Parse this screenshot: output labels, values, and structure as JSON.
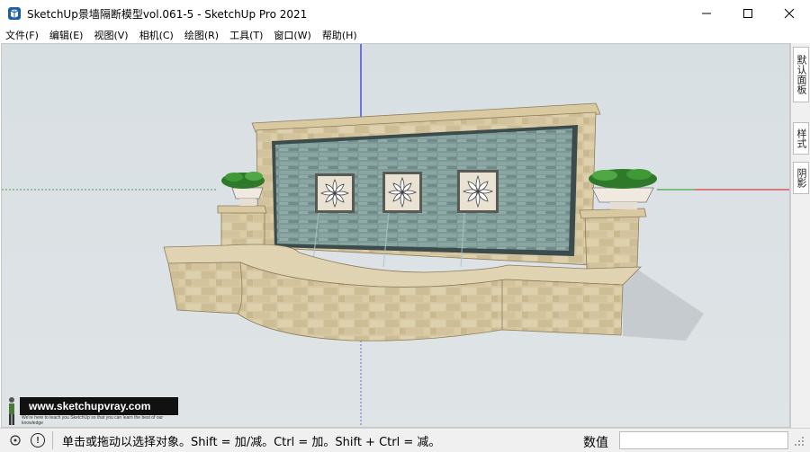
{
  "window": {
    "title": "SketchUp景墙隔断模型vol.061-5 - SketchUp Pro 2021",
    "app_icon": "sketchup-logo-icon"
  },
  "window_controls": [
    "minimize-icon",
    "maximize-icon",
    "close-icon"
  ],
  "menu": [
    "文件(F)",
    "编辑(E)",
    "视图(V)",
    "相机(C)",
    "绘图(R)",
    "工具(T)",
    "窗口(W)",
    "帮助(H)"
  ],
  "tray": {
    "tabs": [
      "默认面板",
      "样式",
      "阴影"
    ]
  },
  "watermark": {
    "site": "www.sketchupvray.com",
    "subtitle": "We're here to teach you SketchUp so that you can learn the best of our knowledge"
  },
  "status": {
    "message": "单击或拖动以选择对象。Shift = 加/减。Ctrl = 加。Shift + Ctrl = 减。",
    "measurements_label": "数值",
    "measurements_value": ""
  },
  "colors": {
    "axis_blue": "#2b2bd6",
    "axis_red": "#d63c3c",
    "axis_green": "#3fa63f",
    "sky": "#d8dfe3",
    "stone": "#cfbf98",
    "water_wall": "#7f9b98"
  }
}
